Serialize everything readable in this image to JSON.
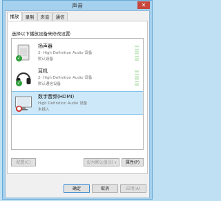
{
  "window": {
    "title": "声音",
    "close_glyph": "✕"
  },
  "tabs": [
    {
      "label": "播放",
      "active": true
    },
    {
      "label": "录制",
      "active": false
    },
    {
      "label": "声音",
      "active": false
    },
    {
      "label": "通信",
      "active": false
    }
  ],
  "panel": {
    "instruction": "选择以下播放设备来修改设置:"
  },
  "devices": [
    {
      "name": "扬声器",
      "description": "2- High Definition Audio 设备",
      "status": "默认设备",
      "badge": "✓",
      "selected": false,
      "icon": "speaker-icon"
    },
    {
      "name": "耳机",
      "description": "2- High Definition Audio 设备",
      "status": "默认通信设备",
      "badge": "✓",
      "selected": false,
      "icon": "headphones-icon"
    },
    {
      "name": "数字音频(HDMI)",
      "description": "High Definition Audio 设备",
      "status": "未插入",
      "badge": "●",
      "selected": true,
      "icon": "monitor-icon"
    }
  ],
  "buttons": {
    "configure": "配置(C)",
    "set_default": "设为默认值(S)",
    "set_default_arrow": "▾",
    "properties": "属性(P)",
    "ok": "确定",
    "cancel": "取消",
    "apply": "应用(A)"
  },
  "colors": {
    "accent": "#7ec1ea",
    "selected_bg": "#cde8f8",
    "check": "#2e9e3a",
    "unplugged": "#c8302a"
  }
}
